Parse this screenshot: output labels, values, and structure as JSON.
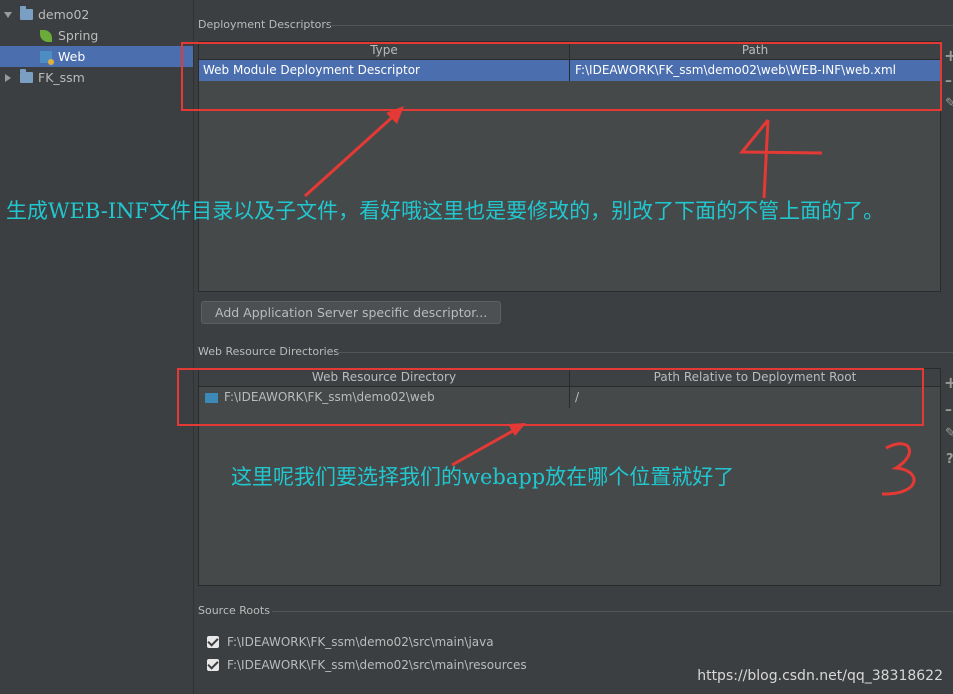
{
  "tree": {
    "items": [
      {
        "label": "demo02",
        "expanded": true,
        "icon": "module-folder-icon"
      },
      {
        "label": "Spring",
        "icon": "spring-icon"
      },
      {
        "label": "Web",
        "icon": "web-facet-icon",
        "selected": true
      },
      {
        "label": "FK_ssm",
        "expanded": false,
        "icon": "module-folder-icon"
      }
    ]
  },
  "deployment": {
    "section_label": "Deployment Descriptors",
    "columns": [
      "Type",
      "Path"
    ],
    "rows": [
      {
        "type": "Web Module Deployment Descriptor",
        "path": "F:\\IDEAWORK\\FK_ssm\\demo02\\web\\WEB-INF\\web.xml",
        "selected": true
      }
    ],
    "add_button": "Add Application Server specific descriptor..."
  },
  "web_resources": {
    "section_label": "Web Resource Directories",
    "columns": [
      "Web Resource Directory",
      "Path Relative to Deployment Root"
    ],
    "rows": [
      {
        "directory": "F:\\IDEAWORK\\FK_ssm\\demo02\\web",
        "relative": "/"
      }
    ]
  },
  "source_roots": {
    "section_label": "Source Roots",
    "items": [
      {
        "path": "F:\\IDEAWORK\\FK_ssm\\demo02\\src\\main\\java",
        "checked": true
      },
      {
        "path": "F:\\IDEAWORK\\FK_ssm\\demo02\\src\\main\\resources",
        "checked": true
      }
    ]
  },
  "annotations": {
    "note1": "生成WEB-INF文件目录以及子文件，看好哦这里也是要修改的，别改了下面的不管上面的了。",
    "note2": "这里呢我们要选择我们的webapp放在哪个位置就好了",
    "number1": "4",
    "number2": "3"
  },
  "watermark": "https://blog.csdn.net/qq_38318622",
  "colors": {
    "background": "#3c3f41",
    "selection": "#4b6eaf",
    "annotation_red": "#e53935",
    "annotation_text": "#21c7cf"
  }
}
